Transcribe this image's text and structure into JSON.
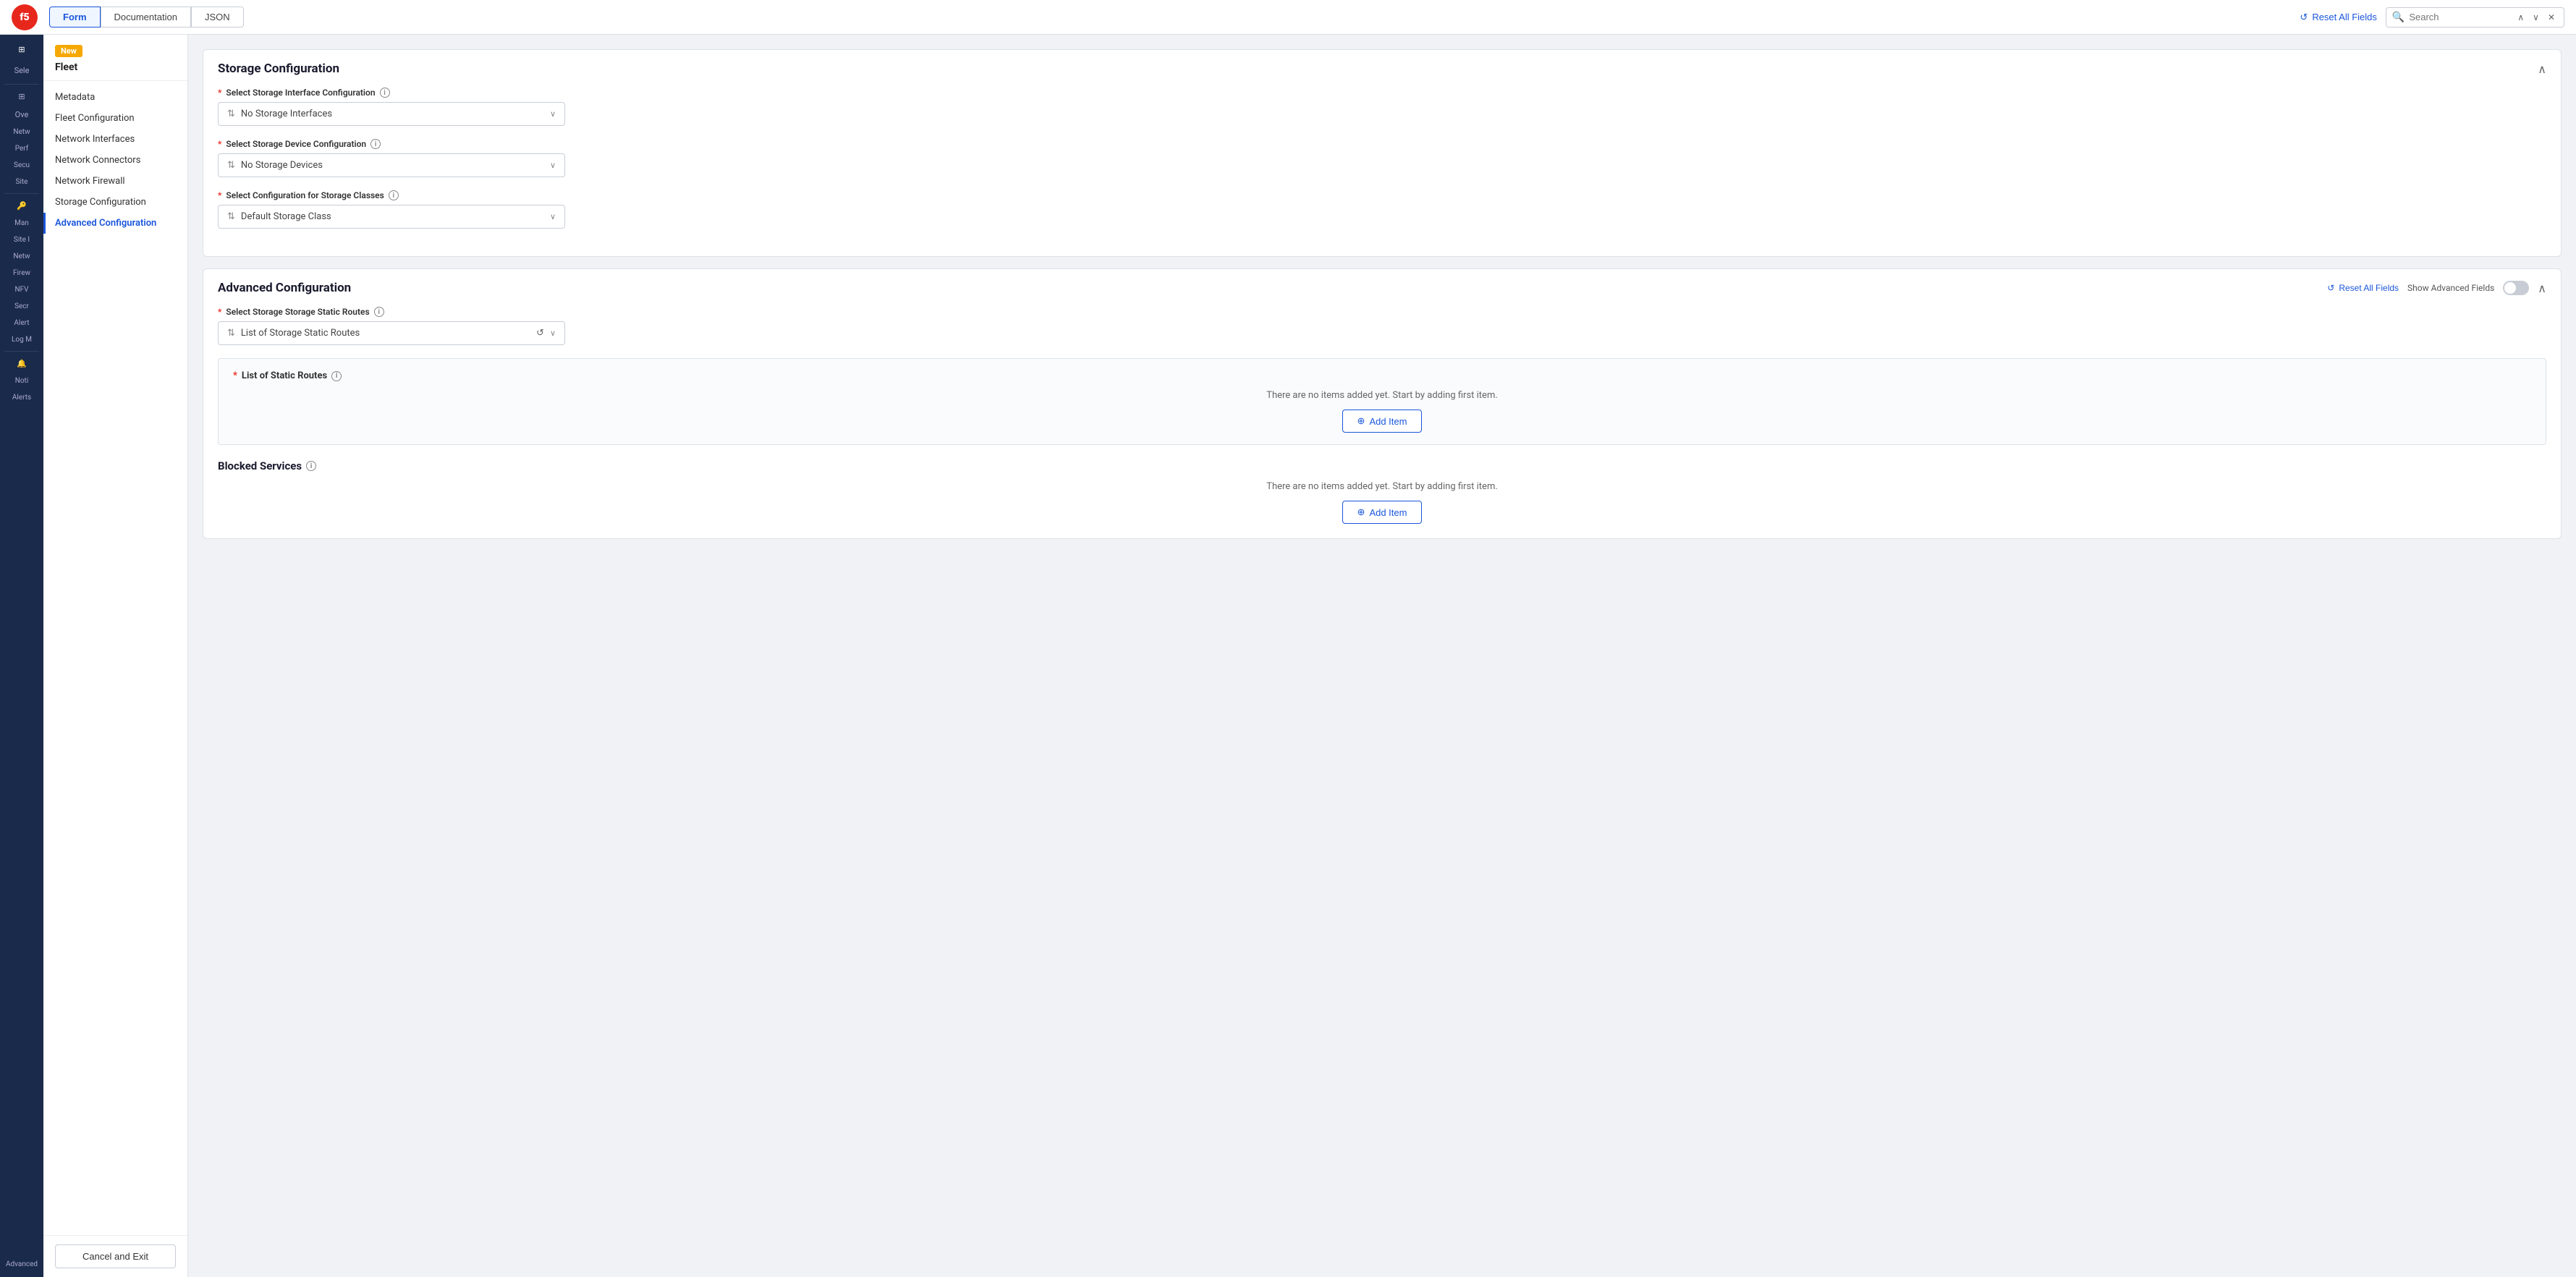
{
  "topbar": {
    "tabs": [
      {
        "id": "form",
        "label": "Form",
        "active": true
      },
      {
        "id": "documentation",
        "label": "Documentation",
        "active": false
      },
      {
        "id": "json",
        "label": "JSON",
        "active": false
      }
    ],
    "reset_all_fields_label": "Reset All Fields",
    "search_placeholder": "Search"
  },
  "sidebar": {
    "badge": "New",
    "title": "Fleet",
    "nav_items": [
      {
        "id": "metadata",
        "label": "Metadata",
        "active": false
      },
      {
        "id": "fleet-configuration",
        "label": "Fleet Configuration",
        "active": false
      },
      {
        "id": "network-interfaces",
        "label": "Network Interfaces",
        "active": false
      },
      {
        "id": "network-connectors",
        "label": "Network Connectors",
        "active": false
      },
      {
        "id": "network-firewall",
        "label": "Network Firewall",
        "active": false
      },
      {
        "id": "storage-configuration",
        "label": "Storage Configuration",
        "active": false
      },
      {
        "id": "advanced-configuration",
        "label": "Advanced Configuration",
        "active": true
      }
    ],
    "left_nav_groups": [
      {
        "label": "Sele"
      },
      {
        "label": "Ove"
      },
      {
        "label": "Netw"
      },
      {
        "label": "Perf"
      },
      {
        "label": "Secu"
      },
      {
        "label": "Site"
      },
      {
        "label": "Man"
      },
      {
        "label": "Site I"
      },
      {
        "label": "Netw"
      },
      {
        "label": "Firew"
      },
      {
        "label": "NFV"
      },
      {
        "label": "Secr"
      },
      {
        "label": "Alert"
      },
      {
        "label": "Log M"
      },
      {
        "label": "Noti"
      },
      {
        "label": "Alerts"
      },
      {
        "label": "Advanced"
      }
    ],
    "cancel_exit_label": "Cancel and Exit"
  },
  "storage_configuration": {
    "title": "Storage Configuration",
    "fields": [
      {
        "id": "storage-interface",
        "label": "Select Storage Interface Configuration",
        "required": true,
        "value": "No Storage Interfaces",
        "has_info": true
      },
      {
        "id": "storage-device",
        "label": "Select Storage Device Configuration",
        "required": true,
        "value": "No Storage Devices",
        "has_info": true
      },
      {
        "id": "storage-class",
        "label": "Select Configuration for Storage Classes",
        "required": true,
        "value": "Default Storage Class",
        "has_info": true
      }
    ]
  },
  "advanced_configuration": {
    "title": "Advanced Configuration",
    "reset_label": "Reset All Fields",
    "show_advanced_label": "Show Advanced Fields",
    "static_routes_field": {
      "label": "Select Storage Storage Static Routes",
      "required": true,
      "value": "List of Storage Static Routes",
      "has_info": true
    },
    "list_of_static_routes": {
      "title": "List of Static Routes",
      "required": true,
      "has_info": true,
      "empty_message": "There are no items added yet. Start by adding first item.",
      "add_item_label": "Add Item"
    },
    "blocked_services": {
      "title": "Blocked Services",
      "has_info": true,
      "empty_message": "There are no items added yet. Start by adding first item.",
      "add_item_label": "Add Item"
    }
  },
  "icons": {
    "reset": "↺",
    "search": "🔍",
    "chevron_up": "∧",
    "chevron_down": "∨",
    "close": "✕",
    "plus_circle": "⊕",
    "select_arrows": "⇅",
    "info": "i"
  }
}
